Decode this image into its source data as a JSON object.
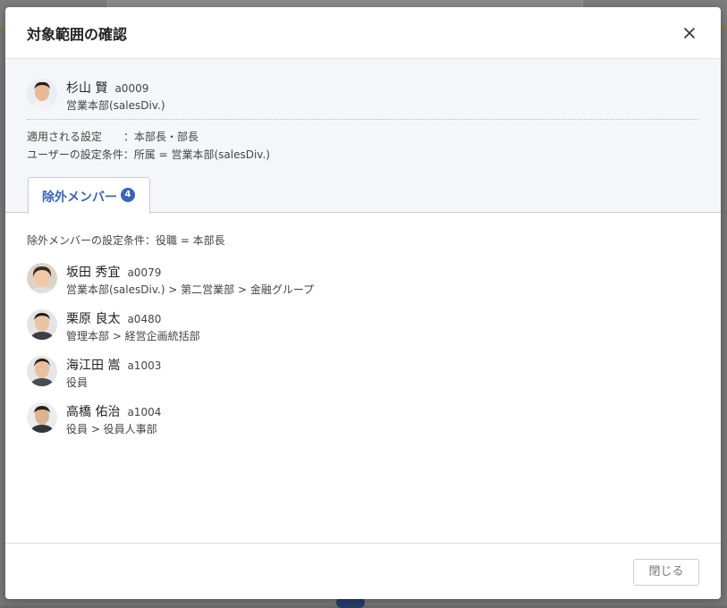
{
  "dialog": {
    "title": "対象範囲の確認",
    "close_label": "閉じる"
  },
  "target_user": {
    "name": "杉山 賢",
    "code": "a0009",
    "org": "営業本部(salesDiv.)"
  },
  "conditions": {
    "applied_setting": "適用される設定　　：本部長・部長",
    "user_condition": "ユーザーの設定条件：所属 = 営業本部(salesDiv.)"
  },
  "tab": {
    "label": "除外メンバー",
    "count": "4"
  },
  "excluded": {
    "condition": "除外メンバーの設定条件：役職 = 本部長",
    "members": [
      {
        "name": "坂田 秀宜",
        "code": "a0079",
        "org": "営業本部(salesDiv.) > 第二営業部 > 金融グループ"
      },
      {
        "name": "栗原 良太",
        "code": "a0480",
        "org": "管理本部 > 経営企画統括部"
      },
      {
        "name": "海江田 嵩",
        "code": "a1003",
        "org": "役員"
      },
      {
        "name": "高橋 佑治",
        "code": "a1004",
        "org": "役員 > 役員人事部"
      }
    ]
  },
  "colors": {
    "accent": "#3a65b8",
    "panel_bg": "#f5f6f9"
  }
}
